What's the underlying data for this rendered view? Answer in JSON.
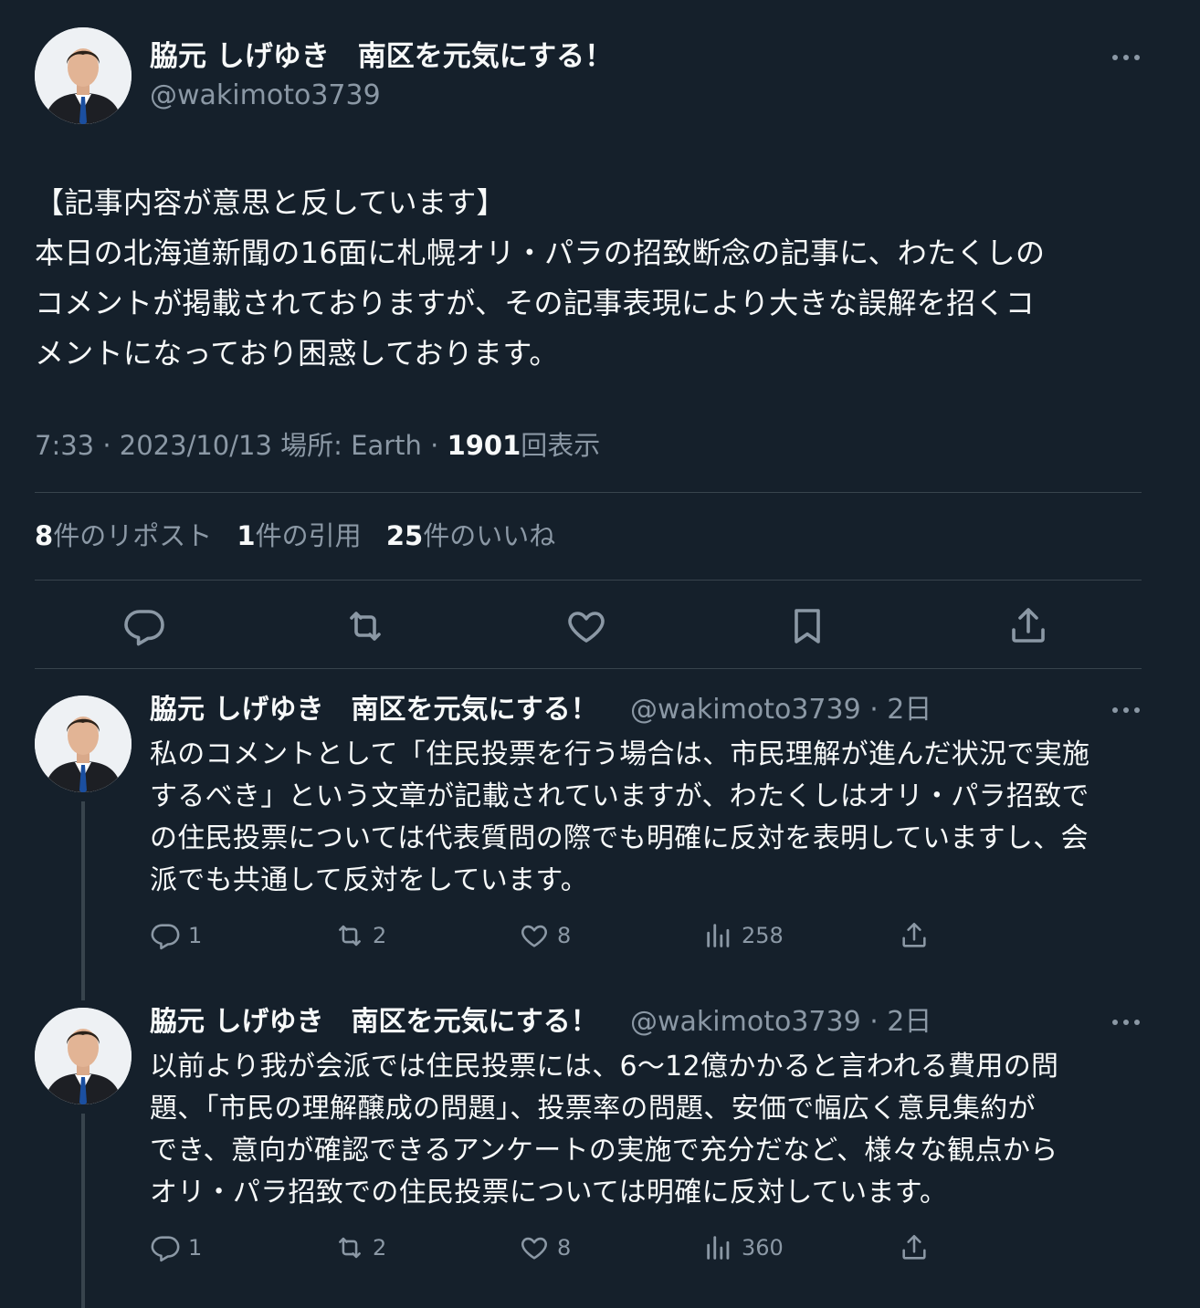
{
  "main_tweet": {
    "author_name": "脇元 しげゆき　南区を元気にする！",
    "handle": "@wakimoto3739",
    "text_lines": [
      "【記事内容が意思と反しています】",
      "本日の北海道新聞の16面に札幌オリ・パラの招致断念の記事に、わたくしの",
      "コメントが掲載されておりますが、その記事表現により大きな誤解を招くコ",
      "メントになっており困惑しております。"
    ],
    "time": "7:33",
    "date": "2023/10/13",
    "location": "場所: Earth",
    "views": "1901",
    "views_label": "回表示",
    "separator": "·",
    "stats": {
      "reposts_count": "8",
      "reposts_label": "件のリポスト",
      "quotes_count": "1",
      "quotes_label": "件の引用",
      "likes_count": "25",
      "likes_label": "件のいいね"
    },
    "actions": [
      "reply-icon",
      "repost-icon",
      "like-icon",
      "bookmark-icon",
      "share-icon"
    ]
  },
  "replies": [
    {
      "author_name": "脇元 しげゆき　南区を元気にする！",
      "handle_time": "@wakimoto3739 · 2日",
      "text_lines": [
        "私のコメントとして「住民投票を行う場合は、市民理解が進んだ状況で実施",
        "するべき」という文章が記載されていますが、わたくしはオリ・パラ招致で",
        "の住民投票については代表質問の際でも明確に反対を表明していますし、会",
        "派でも共通して反対をしています。"
      ],
      "replies": "1",
      "reposts": "2",
      "likes": "8",
      "views": "258"
    },
    {
      "author_name": "脇元 しげゆき　南区を元気にする！",
      "handle_time": "@wakimoto3739 · 2日",
      "text_lines": [
        "以前より我が会派では住民投票には、6〜12億かかると言われる費用の問",
        "題、「市民の理解醸成の問題」、投票率の問題、安価で幅広く意見集約が",
        "でき、意向が確認できるアンケートの実施で充分だなど、様々な観点から",
        "オリ・パラ招致での住民投票については明確に反対しています。"
      ],
      "replies": "1",
      "reposts": "2",
      "likes": "8",
      "views": "360"
    }
  ],
  "colors": {
    "background": "#15202b",
    "text": "#f7f9f9",
    "secondary": "#8b98a5",
    "divider": "#38444d"
  }
}
